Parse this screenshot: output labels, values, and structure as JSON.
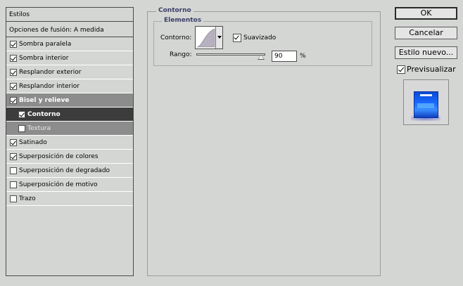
{
  "styles_panel": {
    "header": "Estilos",
    "blend_options": "Opciones de fusión: A medida",
    "items": [
      {
        "label": "Sombra paralela",
        "checked": true
      },
      {
        "label": "Sombra interior",
        "checked": true
      },
      {
        "label": "Resplandor exterior",
        "checked": true
      },
      {
        "label": "Resplandor interior",
        "checked": true
      },
      {
        "label": "Bisel y relieve",
        "checked": true
      },
      {
        "label": "Contorno",
        "checked": true
      },
      {
        "label": "Textura",
        "checked": false
      },
      {
        "label": "Satinado",
        "checked": true
      },
      {
        "label": "Superposición de colores",
        "checked": true
      },
      {
        "label": "Superposición de degradado",
        "checked": false
      },
      {
        "label": "Superposición de motivo",
        "checked": false
      },
      {
        "label": "Trazo",
        "checked": false
      }
    ]
  },
  "contorno": {
    "group_title": "Contorno",
    "elementos_title": "Elementos",
    "contour_label": "Contorno:",
    "smooth_label": "Suavizado",
    "smooth_checked": true,
    "range_label": "Rango:",
    "range_value": "90",
    "range_unit": "%"
  },
  "buttons": {
    "ok": "OK",
    "cancel": "Cancelar",
    "new_style": "Estilo nuevo...",
    "preview": "Previsualizar",
    "preview_checked": true
  },
  "colors": {
    "selected_row": "#3c3c3c",
    "bevel_group": "#8c8c8c",
    "legend_text": "#3b3f68",
    "preview_blue": "#1a6bff"
  }
}
